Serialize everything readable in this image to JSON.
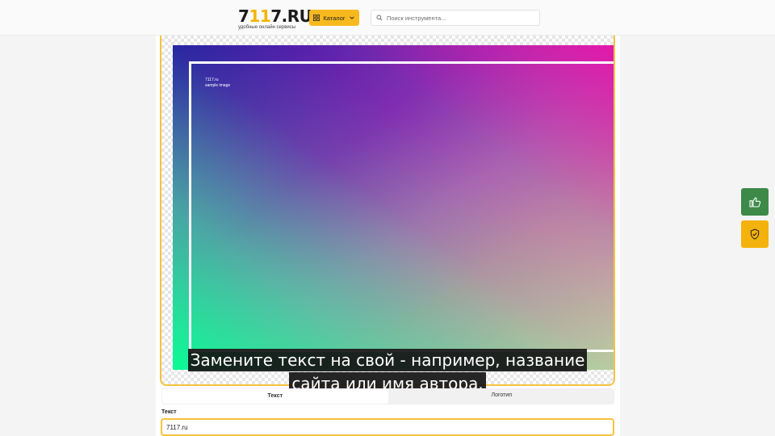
{
  "header": {
    "logo_prefix": "7",
    "logo_highlight": "11",
    "logo_suffix": "7.RU",
    "logo_tagline": "удобные онлайн сервисы",
    "catalog_label": "Каталог",
    "search_placeholder": "Поиск инструмента..."
  },
  "preview": {
    "caption_line1": "7117.ru",
    "caption_line2": "sample image"
  },
  "subtitles": {
    "line1": "Замените текст на свой - например, название",
    "line2": "сайта или имя автора."
  },
  "tabs": [
    {
      "label": "Текст",
      "active": true
    },
    {
      "label": "Логотип",
      "active": false
    }
  ],
  "form": {
    "text_label": "Текст",
    "text_value": "7117.ru"
  },
  "colors": {
    "accent": "#f6c23e",
    "like_button": "#3d8a48",
    "shield_button": "#f4b20c"
  },
  "icons": {
    "catalog": "grid-icon",
    "catalog_chevron": "chevron-down-icon",
    "search": "search-icon",
    "like": "thumbs-up-icon",
    "shield": "shield-check-icon"
  }
}
